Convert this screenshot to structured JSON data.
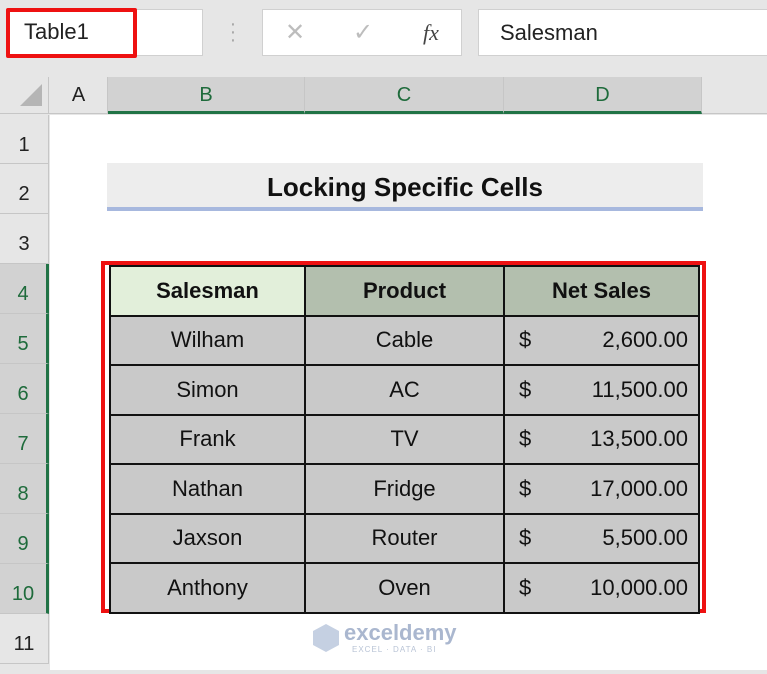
{
  "formula_bar": {
    "name_box": "Table1",
    "cancel_icon": "✕",
    "enter_icon": "✓",
    "fx_label": "fx",
    "formula": "Salesman"
  },
  "columns": [
    "A",
    "B",
    "C",
    "D"
  ],
  "rows": [
    "1",
    "2",
    "3",
    "4",
    "5",
    "6",
    "7",
    "8",
    "9",
    "10",
    "11"
  ],
  "title": "Locking Specific Cells",
  "table": {
    "headers": [
      "Salesman",
      "Product",
      "Net Sales"
    ],
    "currency_symbol": "$",
    "rows": [
      {
        "salesman": "Wilham",
        "product": "Cable",
        "net_sales": "2,600.00"
      },
      {
        "salesman": "Simon",
        "product": "AC",
        "net_sales": "11,500.00"
      },
      {
        "salesman": "Frank",
        "product": "TV",
        "net_sales": "13,500.00"
      },
      {
        "salesman": "Nathan",
        "product": "Fridge",
        "net_sales": "17,000.00"
      },
      {
        "salesman": "Jaxson",
        "product": "Router",
        "net_sales": "5,500.00"
      },
      {
        "salesman": "Anthony",
        "product": "Oven",
        "net_sales": "10,000.00"
      }
    ]
  },
  "watermark": {
    "name": "exceldemy",
    "tagline": "EXCEL · DATA · BI"
  },
  "colors": {
    "selection_highlight": "#ee1111",
    "excel_green": "#217346",
    "header_fill": "#b3bfae",
    "first_header_fill": "#e2efda",
    "body_fill": "#c9c9c9"
  }
}
